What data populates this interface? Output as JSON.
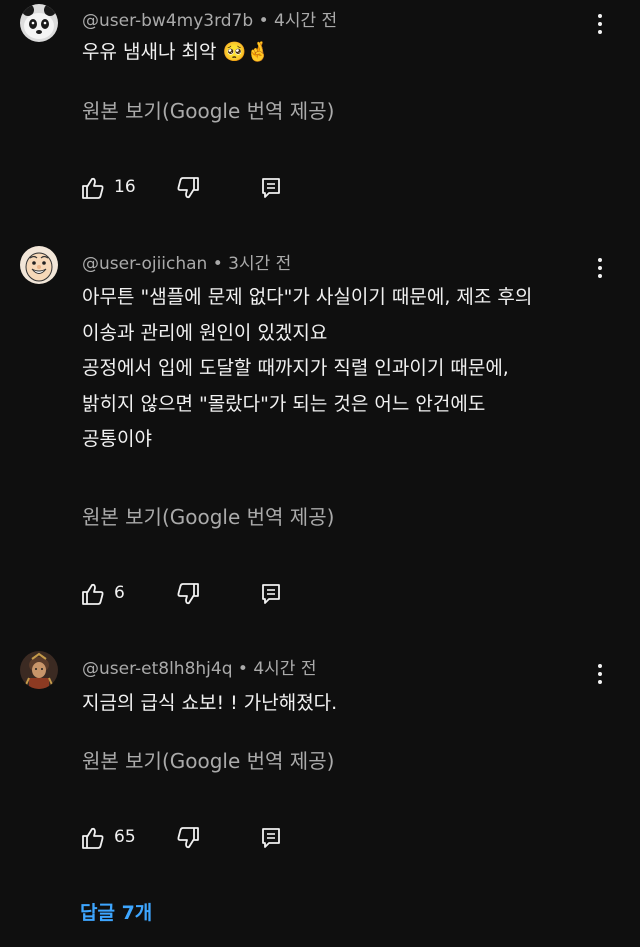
{
  "comments": [
    {
      "author": "@user-bw4my3rd7b",
      "separator": "•",
      "time": "4시간 전",
      "lines": [
        "우유 냄새나 최악 🥺🤞"
      ],
      "translate": "원본 보기(Google 번역 제공)",
      "likes": "16",
      "avatar": "panda-avatar"
    },
    {
      "author": "@user-ojiichan",
      "separator": "•",
      "time": "3시간 전",
      "lines": [
        "아무튼 \"샘플에 문제 없다\"가 사실이기 때문에, 제조 후의",
        "이송과 관리에 원인이 있겠지요",
        "공정에서 입에 도달할 때까지가 직렬 인과이기 때문에,",
        "밝히지 않으면 \"몰랐다\"가 되는 것은 어느 안건에도",
        "공통이야"
      ],
      "translate": "원본 보기(Google 번역 제공)",
      "likes": "6",
      "avatar": "old-man-avatar"
    },
    {
      "author": "@user-et8lh8hj4q",
      "separator": "•",
      "time": "4시간 전",
      "lines": [
        "지금의 급식 쇼보! ! 가난해졌다."
      ],
      "translate": "원본 보기(Google 번역 제공)",
      "likes": "65",
      "avatar": "warrior-avatar"
    }
  ],
  "replies_link": "답글 7개",
  "colors": {
    "background": "#0f0f0f",
    "text": "#f1f1f1",
    "muted": "#aaaaaa",
    "link": "#3ea6ff"
  }
}
